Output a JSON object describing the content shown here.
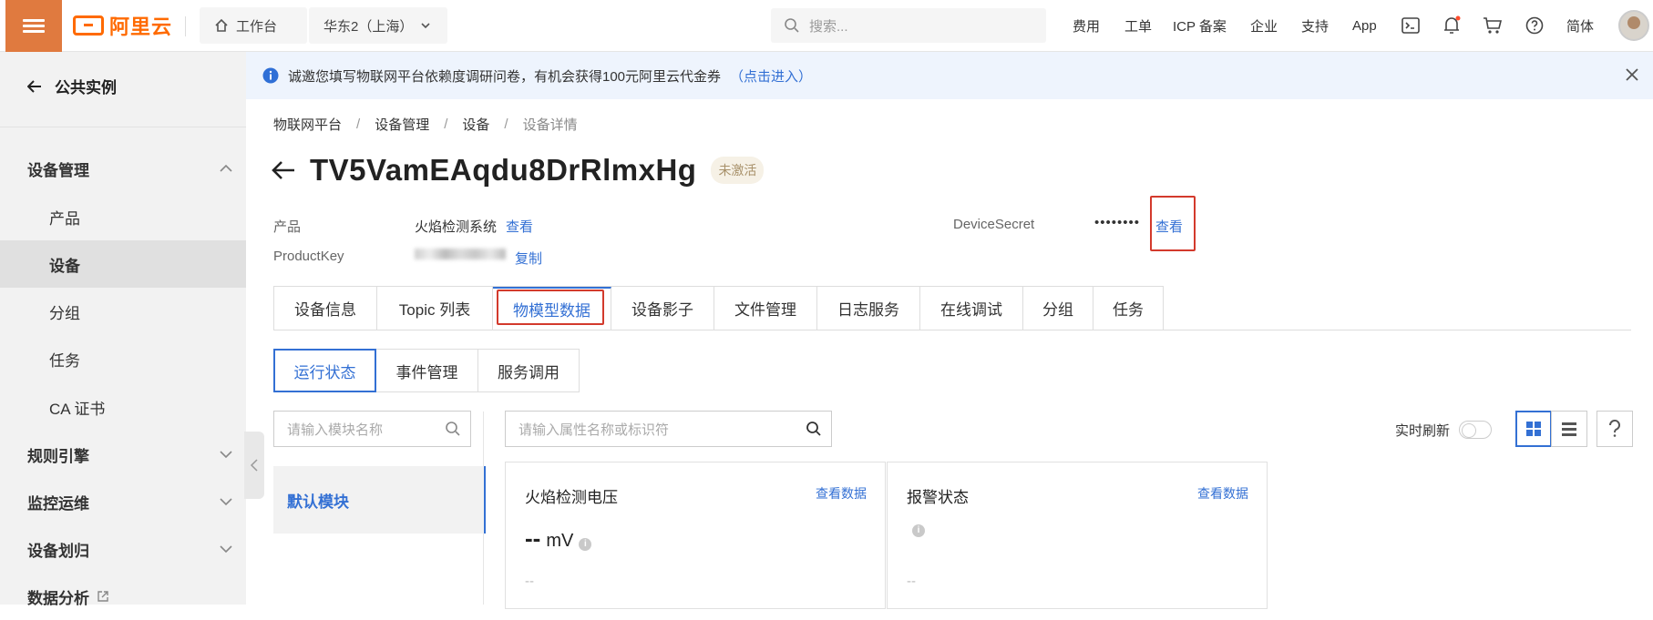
{
  "topbar": {
    "logo_text": "阿里云",
    "workbench_label": "工作台",
    "region_label": "华东2（上海）",
    "search_placeholder": "搜索...",
    "nav": [
      "费用",
      "工单",
      "ICP 备案",
      "企业",
      "支持",
      "App"
    ],
    "lang_label": "简体"
  },
  "sidebar": {
    "back_label": "公共实例",
    "groups": {
      "device_mgmt": "设备管理",
      "rule_engine": "规则引擎",
      "monitor_ops": "监控运维",
      "device_assign": "设备划归",
      "data_analysis": "数据分析"
    },
    "items": [
      "产品",
      "设备",
      "分组",
      "任务",
      "CA 证书"
    ],
    "active_item": "设备"
  },
  "notice": {
    "text": "诚邀您填写物联网平台依赖度调研问卷，有机会获得100元阿里云代金券",
    "link": "（点击进入）"
  },
  "breadcrumb": [
    "物联网平台",
    "设备管理",
    "设备",
    "设备详情"
  ],
  "device": {
    "name": "TV5VamEAqdu8DrRlmxHg",
    "status": "未激活",
    "product_label": "产品",
    "product_value": "火焰检测系统",
    "product_view": "查看",
    "productkey_label": "ProductKey",
    "productkey_copy": "复制",
    "secret_label": "DeviceSecret",
    "secret_value": "••••••••",
    "secret_view": "查看"
  },
  "tabs": [
    "设备信息",
    "Topic 列表",
    "物模型数据",
    "设备影子",
    "文件管理",
    "日志服务",
    "在线调试",
    "分组",
    "任务"
  ],
  "active_tab": "物模型数据",
  "subtabs": [
    "运行状态",
    "事件管理",
    "服务调用"
  ],
  "active_subtab": "运行状态",
  "filters": {
    "module_placeholder": "请输入模块名称",
    "property_placeholder": "请输入属性名称或标识符",
    "realtime_label": "实时刷新",
    "realtime_on": false
  },
  "modules": [
    "默认模块"
  ],
  "cards": [
    {
      "title": "火焰检测电压",
      "link": "查看数据",
      "value": "--",
      "unit": "mV",
      "footer": "--"
    },
    {
      "title": "报警状态",
      "link": "查看数据",
      "value": "",
      "unit": "",
      "footer": "--"
    }
  ],
  "colors": {
    "accent": "#3370d4",
    "brand": "#ff6a00",
    "highlight": "#d33a2c"
  }
}
